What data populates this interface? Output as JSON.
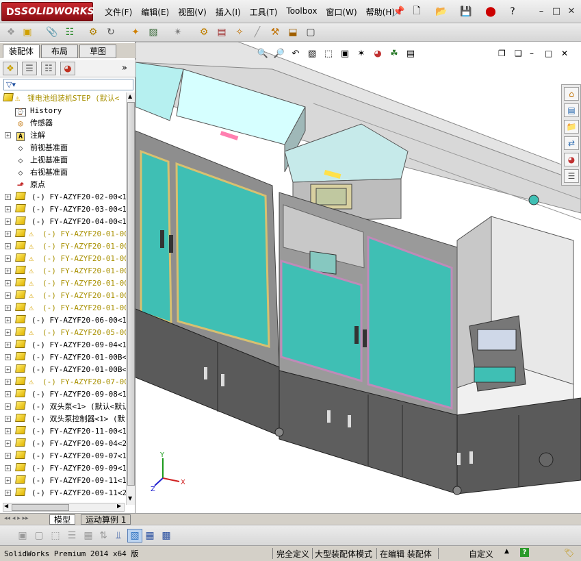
{
  "app": {
    "logo_text": "SOLIDWORKS",
    "logo_prefix": "DS"
  },
  "menu": [
    "文件(F)",
    "编辑(E)",
    "视图(V)",
    "插入(I)",
    "工具(T)",
    "Toolbox",
    "窗口(W)",
    "帮助(H)"
  ],
  "tabs": {
    "assembly": "装配体",
    "layout": "布局",
    "sketch": "草图"
  },
  "tree": {
    "root": "锂电池组装机STEP  (默认<",
    "items": [
      {
        "icon": "history",
        "label": "History",
        "expand": false,
        "warn": false
      },
      {
        "icon": "sensor",
        "label": "传感器",
        "expand": false,
        "warn": false
      },
      {
        "icon": "annotation",
        "label": "注解",
        "expand": true,
        "warn": false
      },
      {
        "icon": "plane",
        "label": "前视基准面",
        "expand": false,
        "warn": false
      },
      {
        "icon": "plane",
        "label": "上视基准面",
        "expand": false,
        "warn": false
      },
      {
        "icon": "plane",
        "label": "右视基准面",
        "expand": false,
        "warn": false
      },
      {
        "icon": "origin",
        "label": "原点",
        "expand": false,
        "warn": false
      },
      {
        "icon": "part",
        "label": "(-) FY-AZYF20-02-00<1>",
        "expand": true,
        "warn": false
      },
      {
        "icon": "part",
        "label": "(-) FY-AZYF20-03-00<1>",
        "expand": true,
        "warn": false
      },
      {
        "icon": "part",
        "label": "(-) FY-AZYF20-04-00<1>",
        "expand": true,
        "warn": false
      },
      {
        "icon": "part",
        "label": "(-) FY-AZYF20-01-00<",
        "expand": true,
        "warn": true
      },
      {
        "icon": "part",
        "label": "(-) FY-AZYF20-01-00<",
        "expand": true,
        "warn": true
      },
      {
        "icon": "part",
        "label": "(-) FY-AZYF20-01-00<",
        "expand": true,
        "warn": true
      },
      {
        "icon": "part",
        "label": "(-) FY-AZYF20-01-00<",
        "expand": true,
        "warn": true
      },
      {
        "icon": "part",
        "label": "(-) FY-AZYF20-01-00<",
        "expand": true,
        "warn": true
      },
      {
        "icon": "part",
        "label": "(-) FY-AZYF20-01-00<",
        "expand": true,
        "warn": true
      },
      {
        "icon": "part",
        "label": "(-) FY-AZYF20-01-00<",
        "expand": true,
        "warn": true
      },
      {
        "icon": "part",
        "label": "(-) FY-AZYF20-06-00<1>",
        "expand": true,
        "warn": false
      },
      {
        "icon": "part",
        "label": "(-) FY-AZYF20-05-00<",
        "expand": true,
        "warn": true
      },
      {
        "icon": "part",
        "label": "(-) FY-AZYF20-09-04<1>",
        "expand": true,
        "warn": false
      },
      {
        "icon": "part",
        "label": "(-) FY-AZYF20-01-00B<1>",
        "expand": true,
        "warn": false
      },
      {
        "icon": "part",
        "label": "(-) FY-AZYF20-01-00B<2>",
        "expand": true,
        "warn": false
      },
      {
        "icon": "part",
        "label": "(-) FY-AZYF20-07-00<",
        "expand": true,
        "warn": true
      },
      {
        "icon": "part",
        "label": "(-) FY-AZYF20-09-08<1>",
        "expand": true,
        "warn": false
      },
      {
        "icon": "part",
        "label": "(-) 双头泵<1> (默认<默认",
        "expand": true,
        "warn": false
      },
      {
        "icon": "part",
        "label": "(-) 双头泵控制器<1> (默",
        "expand": true,
        "warn": false
      },
      {
        "icon": "part",
        "label": "(-) FY-AZYF20-11-00<1>",
        "expand": true,
        "warn": false
      },
      {
        "icon": "part",
        "label": "(-) FY-AZYF20-09-04<2>",
        "expand": true,
        "warn": false
      },
      {
        "icon": "part",
        "label": "(-) FY-AZYF20-09-07<1>",
        "expand": true,
        "warn": false
      },
      {
        "icon": "part",
        "label": "(-) FY-AZYF20-09-09<1>",
        "expand": true,
        "warn": false
      },
      {
        "icon": "part",
        "label": "(-) FY-AZYF20-09-11<1>",
        "expand": true,
        "warn": false
      },
      {
        "icon": "part",
        "label": "(-) FY-AZYF20-09-11<2>",
        "expand": true,
        "warn": false
      }
    ]
  },
  "bottom_tabs": {
    "model": "模型",
    "motion": "运动算例 1"
  },
  "status": {
    "product": "SolidWorks Premium 2014 x64 版",
    "defined": "完全定义",
    "mode": "大型装配体模式",
    "editing": "在编辑 装配体",
    "custom": "自定义",
    "help": "?"
  },
  "triad": {
    "x": "X",
    "y": "Y",
    "z": "Z"
  },
  "colors": {
    "panel_glass": "#3fbfb4",
    "frame": "#7a7a7a",
    "cabinet": "#5a5a5a",
    "logo": "#b8222a"
  }
}
